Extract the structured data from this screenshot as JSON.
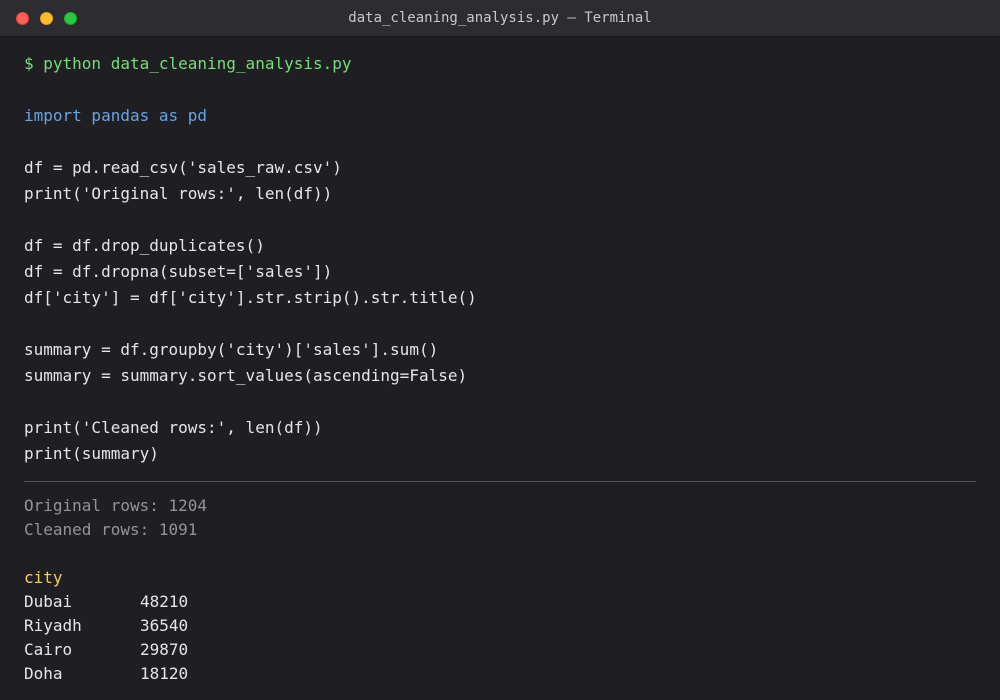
{
  "window": {
    "title": "data_cleaning_analysis.py — Terminal"
  },
  "terminal": {
    "command": "$ python data_cleaning_analysis.py",
    "code": {
      "import_line": "import pandas as pd",
      "read_csv": "df = pd.read_csv('sales_raw.csv')",
      "print_original": "print('Original rows:', len(df))",
      "drop_duplicates": "df = df.drop_duplicates()",
      "dropna": "df = df.dropna(subset=['sales'])",
      "strip_title": "df['city'] = df['city'].str.strip().str.title()",
      "groupby": "summary = df.groupby('city')['sales'].sum()",
      "sort_values": "summary = summary.sort_values(ascending=False)",
      "print_cleaned": "print('Cleaned rows:', len(df))",
      "print_summary": "print(summary)"
    },
    "output": {
      "original_rows": "Original rows: 1204",
      "cleaned_rows": "Cleaned rows: 1091",
      "summary_header": "city",
      "summary_rows": [
        {
          "city": "Dubai",
          "value": "48210"
        },
        {
          "city": "Riyadh",
          "value": "36540"
        },
        {
          "city": "Cairo",
          "value": "29870"
        },
        {
          "city": "Doha",
          "value": "18120"
        }
      ]
    }
  },
  "colors": {
    "background": "#1f1e22",
    "prompt": "#79dc7b",
    "keyword": "#6aa3e0",
    "output": "#959398",
    "header": "#f3d160"
  }
}
